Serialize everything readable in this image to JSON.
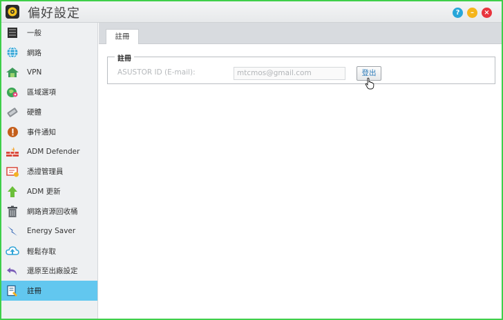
{
  "window": {
    "title": "偏好設定"
  },
  "titlebar_buttons": {
    "help": "?",
    "minimize": "–",
    "close": "×"
  },
  "sidebar": {
    "items": [
      {
        "label": "一般",
        "icon": "general-icon"
      },
      {
        "label": "網路",
        "icon": "network-globe-icon"
      },
      {
        "label": "VPN",
        "icon": "vpn-icon"
      },
      {
        "label": "區域選項",
        "icon": "region-icon"
      },
      {
        "label": "硬體",
        "icon": "hardware-icon"
      },
      {
        "label": "事件通知",
        "icon": "notification-icon"
      },
      {
        "label": "ADM Defender",
        "icon": "firewall-icon"
      },
      {
        "label": "憑證管理員",
        "icon": "certificate-icon"
      },
      {
        "label": "ADM 更新",
        "icon": "update-arrow-icon"
      },
      {
        "label": "網路資源回收桶",
        "icon": "recycle-bin-icon"
      },
      {
        "label": "Energy Saver",
        "icon": "energy-saver-icon"
      },
      {
        "label": "輕鬆存取",
        "icon": "cloud-access-icon"
      },
      {
        "label": "還原至出廠設定",
        "icon": "restore-icon"
      },
      {
        "label": "註冊",
        "icon": "registration-icon",
        "active": true
      }
    ]
  },
  "main": {
    "tabs": [
      {
        "label": "註冊"
      }
    ],
    "section": {
      "legend": "註冊",
      "field_label": "ASUSTOR ID (E-mail):",
      "field_value": "mtcmos@gmail.com",
      "button_label": "登出"
    }
  },
  "colors": {
    "accent_active": "#62c7ef",
    "window_border": "#3fcf4a",
    "help": "#27a6d9",
    "minimize": "#f5b51b",
    "close": "#e8343d"
  }
}
